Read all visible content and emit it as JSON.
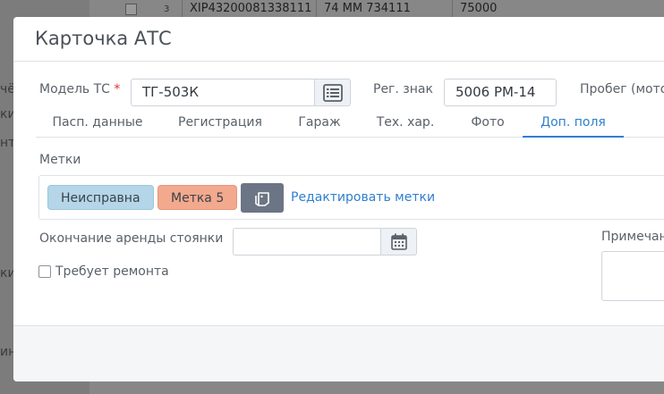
{
  "background": {
    "sidebar_fragments": [
      "чё",
      "ки",
      "нт",
      "ки",
      "ин"
    ],
    "table_row": {
      "index": "3",
      "vin": "XIP43200081338111",
      "number": "74 ММ 734111",
      "value": "75000"
    }
  },
  "modal": {
    "title": "Карточка АТС",
    "model": {
      "label": "Модель ТС",
      "required_mark": "*",
      "value": "ТГ-503К"
    },
    "reg_sign": {
      "label": "Рег. знак",
      "value": "5006 РМ-14"
    },
    "mileage_label": "Пробег (мото",
    "tabs": [
      {
        "label": "Пасп. данные"
      },
      {
        "label": "Регистрация"
      },
      {
        "label": "Гараж"
      },
      {
        "label": "Тех. хар."
      },
      {
        "label": "Фото"
      },
      {
        "label": "Доп. поля",
        "active": true
      }
    ],
    "tags": {
      "label": "Метки",
      "items": [
        {
          "label": "Неисправна",
          "color": "#b4d6e8"
        },
        {
          "label": "Метка 5",
          "color": "#f2a98e"
        }
      ],
      "edit_link": "Редактировать метки"
    },
    "parking_lease_end": {
      "label": "Окончание аренды стоянки",
      "value": ""
    },
    "needs_repair": {
      "label": "Требует ремонта",
      "checked": false
    },
    "note_label": "Примечан"
  },
  "colors": {
    "accent": "#2f7fd0",
    "required": "#e03131"
  }
}
